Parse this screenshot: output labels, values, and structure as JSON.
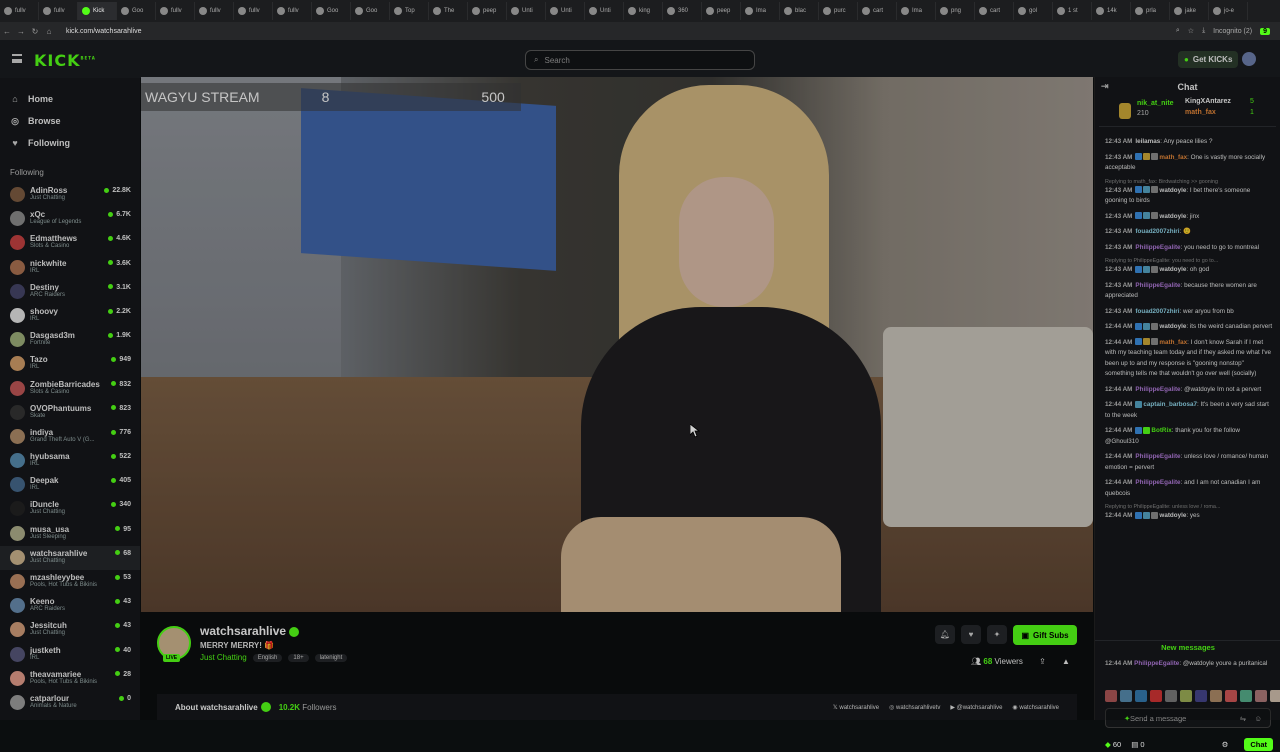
{
  "browser": {
    "url": "kick.com/watchsarahlive",
    "tabs": [
      "fullv",
      "fullv",
      "Kick",
      "Goo",
      "fullv",
      "fullv",
      "fullv",
      "fullv",
      "Goo",
      "Goo",
      "Top",
      "The",
      "peep",
      "Unti",
      "Unti",
      "Unti",
      "king",
      "360",
      "peep",
      "Ima",
      "blac",
      "purc",
      "cart",
      "Ima",
      "png",
      "cart",
      "gol",
      "1 st",
      "14k",
      "prla",
      "jake",
      "jo-e"
    ],
    "profile": "Incognito (2)",
    "ext_badge": "9"
  },
  "topbar": {
    "logo": "KICK",
    "logo_sup": "BETA",
    "search_placeholder": "Search",
    "get_kicks": "Get KICKs"
  },
  "sidebar": {
    "nav": [
      {
        "label": "Home",
        "icon": "home-icon"
      },
      {
        "label": "Browse",
        "icon": "compass-icon"
      },
      {
        "label": "Following",
        "icon": "heart-icon"
      }
    ],
    "following_label": "Following",
    "following": [
      {
        "name": "AdinRoss",
        "cat": "Just Chatting",
        "viewers": "22.8K",
        "color": "#7a5a40"
      },
      {
        "name": "xQc",
        "cat": "League of Legends",
        "viewers": "6.7K",
        "color": "#888"
      },
      {
        "name": "Edmatthews",
        "cat": "Slots & Casino",
        "viewers": "4.6K",
        "color": "#c04040"
      },
      {
        "name": "nickwhite",
        "cat": "IRL",
        "viewers": "3.6K",
        "color": "#a87050"
      },
      {
        "name": "Destiny",
        "cat": "ARC Raiders",
        "viewers": "3.1K",
        "color": "#446"
      },
      {
        "name": "shoovy",
        "cat": "IRL",
        "viewers": "2.2K",
        "color": "#ddd"
      },
      {
        "name": "Dasgasd3m",
        "cat": "Fortnite",
        "viewers": "1.9K",
        "color": "#9a7"
      },
      {
        "name": "Tazo",
        "cat": "IRL",
        "viewers": "949",
        "color": "#c96"
      },
      {
        "name": "ZombieBarricades",
        "cat": "Slots & Casino",
        "viewers": "832",
        "color": "#b55"
      },
      {
        "name": "OVOPhantuums",
        "cat": "Skate",
        "viewers": "823",
        "color": "#333"
      },
      {
        "name": "indiya",
        "cat": "Grand Theft Auto V (G...",
        "viewers": "776",
        "color": "#a86"
      },
      {
        "name": "hyubsama",
        "cat": "IRL",
        "viewers": "522",
        "color": "#58a"
      },
      {
        "name": "Deepak",
        "cat": "IRL",
        "viewers": "405",
        "color": "#468"
      },
      {
        "name": "iDuncle",
        "cat": "Just Chatting",
        "viewers": "340",
        "color": "#222"
      },
      {
        "name": "musa_usa",
        "cat": "Just Sleeping",
        "viewers": "95",
        "color": "#aa8"
      },
      {
        "name": "watchsarahlive",
        "cat": "Just Chatting",
        "viewers": "68",
        "color": "#c8b08a",
        "active": true
      },
      {
        "name": "mzashleyybee",
        "cat": "Pools, Hot Tubs & Bikinis",
        "viewers": "53",
        "color": "#b86"
      },
      {
        "name": "Keeno",
        "cat": "ARC Raiders",
        "viewers": "43",
        "color": "#68a"
      },
      {
        "name": "Jessitcuh",
        "cat": "Just Chatting",
        "viewers": "43",
        "color": "#c97"
      },
      {
        "name": "justketh",
        "cat": "IRL",
        "viewers": "40",
        "color": "#557"
      },
      {
        "name": "theavamariee",
        "cat": "Pools, Hot Tubs & Bikinis",
        "viewers": "28",
        "color": "#d98"
      },
      {
        "name": "catparlour",
        "cat": "Animals & Nature",
        "viewers": "0",
        "color": "#999"
      }
    ]
  },
  "video": {
    "overlay_title": "WAGYU STREAM",
    "overlay_num1": "8",
    "overlay_num2": "500"
  },
  "channel": {
    "name": "watchsarahlive",
    "title": "MERRY MERRY! 🎁",
    "category": "Just Chatting",
    "tags": [
      "English",
      "18+",
      "latenight"
    ],
    "live": "LIVE",
    "viewers_count": "68",
    "viewers_label": "Viewers",
    "gift_subs": "Gift Subs",
    "about": "About watchsarahlive",
    "followers_count": "10.2K",
    "followers_label": "Followers",
    "socials": [
      "watchsarahlive",
      "watchsarahlivetv",
      "@watchsarahlive",
      "watchsarahlive"
    ]
  },
  "chat": {
    "title": "Chat",
    "leader": {
      "name1": "nik_at_nite",
      "sub1": "210",
      "name2": "KingXAntarez",
      "count2": "5",
      "name3": "math_fax",
      "count3": "1"
    },
    "messages": [
      {
        "ts": "12:43 AM",
        "user": "leilamas",
        "color": "#e0e0e0",
        "text": "Any peace lilies ?"
      },
      {
        "ts": "12:43 AM",
        "user": "math_fax",
        "color": "#e6883a",
        "text": "One is vastly more socially acceptable",
        "badges": [
          "#3a8ad8",
          "#c9a436",
          "#888"
        ]
      },
      {
        "reply": "Replying to math_fax: Birdwatching >> gooning",
        "ts": "12:43 AM",
        "user": "watdoyle",
        "color": "#e0e0e0",
        "text": "I bet there's someone gooning to birds",
        "badges": [
          "#3a8ad8",
          "#53a0c0",
          "#888"
        ]
      },
      {
        "ts": "12:43 AM",
        "user": "watdoyle",
        "color": "#e0e0e0",
        "text": "jinx",
        "badges": [
          "#3a8ad8",
          "#53a0c0",
          "#888"
        ]
      },
      {
        "ts": "12:43 AM",
        "user": "fouad2007zhiri",
        "color": "#8fd4e8",
        "text": "🙂"
      },
      {
        "ts": "12:43 AM",
        "user": "PhilippeEgalite",
        "color": "#b07ad8",
        "text": "you need to go to montreal"
      },
      {
        "reply": "Replying to PhilippeEgalite: you need to go to...",
        "ts": "12:43 AM",
        "user": "watdoyle",
        "color": "#e0e0e0",
        "text": "oh god",
        "badges": [
          "#3a8ad8",
          "#53a0c0",
          "#888"
        ]
      },
      {
        "ts": "12:43 AM",
        "user": "PhilippeEgalite",
        "color": "#b07ad8",
        "text": "because there women are appreciated"
      },
      {
        "ts": "12:43 AM",
        "user": "fouad2007zhiri",
        "color": "#8fd4e8",
        "text": "wer aryou from bb"
      },
      {
        "ts": "12:44 AM",
        "user": "watdoyle",
        "color": "#e0e0e0",
        "text": "its the weird canadian pervert",
        "badges": [
          "#3a8ad8",
          "#53a0c0",
          "#888"
        ]
      },
      {
        "ts": "12:44 AM",
        "user": "math_fax",
        "color": "#e6883a",
        "text": "I don't know Sarah if I met with my teaching team today and if they asked me what I've been up to and my response is \"gooning nonstop\" something tells me that wouldn't go over well (socially)",
        "badges": [
          "#3a8ad8",
          "#c9a436",
          "#888"
        ]
      },
      {
        "ts": "12:44 AM",
        "user": "PhilippeEgalite",
        "color": "#b07ad8",
        "text": "@watdoyle Im not a pervert"
      },
      {
        "ts": "12:44 AM",
        "user": "captain_barbosa7",
        "color": "#8fd4e8",
        "text": "It's been a very sad start to the week",
        "badges": [
          "#53a0c0"
        ]
      },
      {
        "ts": "12:44 AM",
        "user": "BotRix",
        "color": "#53fc18",
        "text": "thank you for the follow @Ghoul310",
        "badges": [
          "#3a8ad8",
          "#53fc18"
        ]
      },
      {
        "ts": "12:44 AM",
        "user": "PhilippeEgalite",
        "color": "#b07ad8",
        "text": "unless love / romance/ human emotion = pervert"
      },
      {
        "ts": "12:44 AM",
        "user": "PhilippeEgalite",
        "color": "#b07ad8",
        "text": "and I am not canadian I am quebcois"
      },
      {
        "reply": "Replying to PhilippeEgalite: unless love / roma...",
        "ts": "12:44 AM",
        "user": "watdoyle",
        "color": "#e0e0e0",
        "text": "yes",
        "badges": [
          "#3a8ad8",
          "#53a0c0",
          "#888"
        ]
      }
    ],
    "new_messages": "New messages",
    "last_message": {
      "ts": "12:44 AM",
      "user": "PhilippeEgalite",
      "color": "#b07ad8",
      "text": "@watdoyle youre a puritanical"
    },
    "input_placeholder": "Send a message",
    "points": "60",
    "count": "0",
    "chat_button": "Chat"
  }
}
